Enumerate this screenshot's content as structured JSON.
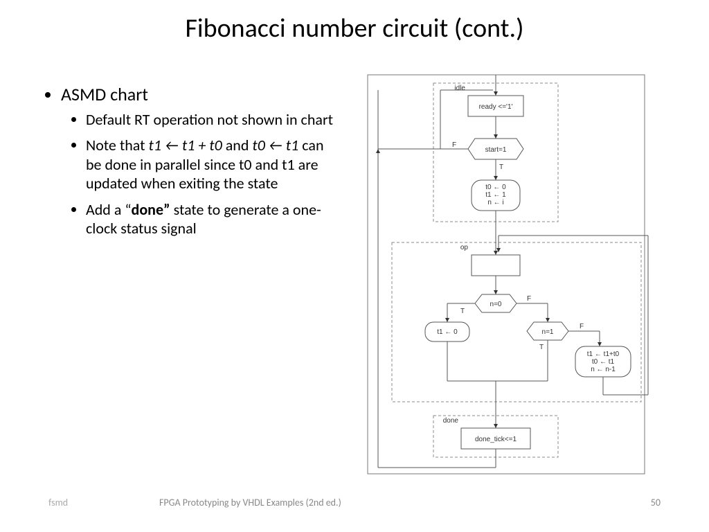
{
  "title": "Fibonacci number circuit (cont.)",
  "bullets": {
    "l1": "ASMD chart",
    "l2a": "Default RT operation not shown in chart",
    "l2b_pre": "Note that ",
    "l2b_i1": "t1 ← t1 + t0",
    "l2b_mid": " and ",
    "l2b_i2": "t0 ← t1",
    "l2b_post": " can be done in parallel since t0 and t1 are updated when exiting the state",
    "l2c_pre": "Add a “",
    "l2c_bold": "done”",
    "l2c_post": " state to generate a one-clock status signal"
  },
  "diagram": {
    "state_idle": "idle",
    "state_op": "op",
    "state_done": "done",
    "box_ready": "ready <='1'",
    "dec_start": "start=1",
    "ov_init_l1": "t0 ← 0",
    "ov_init_l2": "t1 ← 1",
    "ov_init_l3": "n ← i",
    "dec_n0": "n=0",
    "dec_n1": "n=1",
    "ov_t1_0": "t1 ← 0",
    "ov_upd_l1": "t1 ← t1+t0",
    "ov_upd_l2": "t0 ← t1",
    "ov_upd_l3": "n ← n-1",
    "box_done_tick": "done_tick<=1",
    "edge_T": "T",
    "edge_F": "F"
  },
  "footer": {
    "left": "fsmd",
    "mid": "FPGA Prototyping by VHDL Examples (2nd ed.)",
    "right": "50"
  }
}
